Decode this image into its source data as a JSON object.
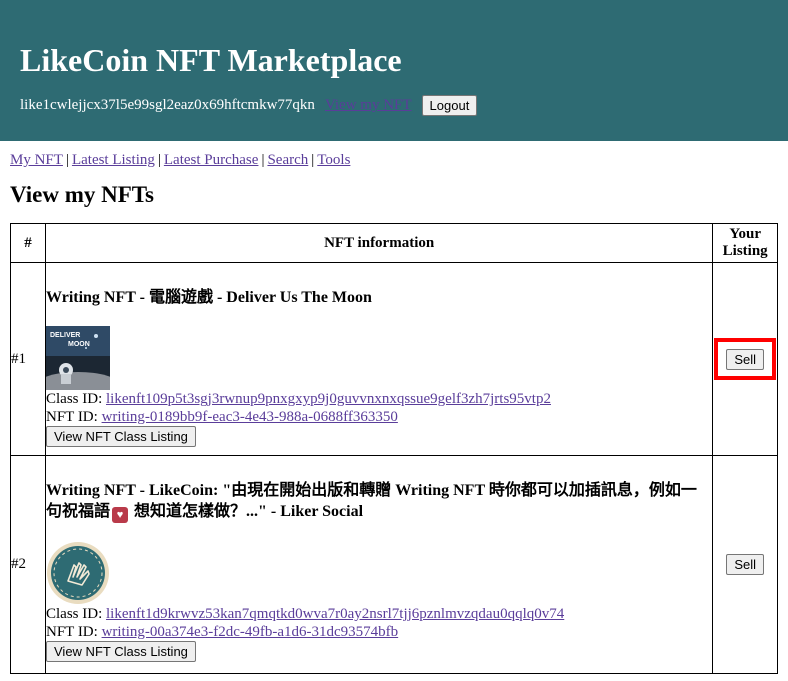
{
  "header": {
    "title": "LikeCoin NFT Marketplace",
    "address": "like1cwlejjcx37l5e99sgl2eaz0x69hftcmkw77qkn",
    "view_link": "View my NFT",
    "logout_label": "Logout"
  },
  "nav": {
    "items": [
      "My NFT",
      "Latest Listing",
      "Latest Purchase",
      "Search",
      "Tools"
    ],
    "separator": "|"
  },
  "page_title": "View my NFTs",
  "table": {
    "headers": {
      "num": "#",
      "info": "NFT information",
      "listing_line1": "Your",
      "listing_line2": "Listing"
    },
    "rows": [
      {
        "num": "#1",
        "name": "Writing NFT - 電腦遊戲 - Deliver Us The Moon",
        "class_id_label": "Class ID:",
        "class_id": "likenft109p5t3sgj3rwnup9pnxgxyp9j0guvvnxnxqssue9gelf3zh7jrts95vtp2",
        "nft_id_label": "NFT ID:",
        "nft_id": "writing-0189bb9f-eac3-4e43-988a-0688ff363350",
        "view_class_label": "View NFT Class Listing",
        "sell_label": "Sell",
        "thumb_text": "DELIVER US THE MOON"
      },
      {
        "num": "#2",
        "name_part1": "Writing NFT - LikeCoin: \"由現在開始出版和轉贈 Writing NFT 時你都可以加插訊息，例如一句祝福語",
        "name_part2": " 想知道怎樣做？...\" - Liker Social",
        "class_id_label": "Class ID:",
        "class_id": "likenft1d9krwvz53kan7qmqtkd0wva7r0ay2nsrl7tjj6pznlmvzqdau0qqlq0v74",
        "nft_id_label": "NFT ID:",
        "nft_id": "writing-00a374e3-f2dc-49fb-a1d6-31dc93574bfb",
        "view_class_label": "View NFT Class Listing",
        "sell_label": "Sell"
      }
    ]
  },
  "colors": {
    "header_bg": "#2e6b73",
    "link": "#5a3d9a",
    "highlight": "#ff0000"
  }
}
